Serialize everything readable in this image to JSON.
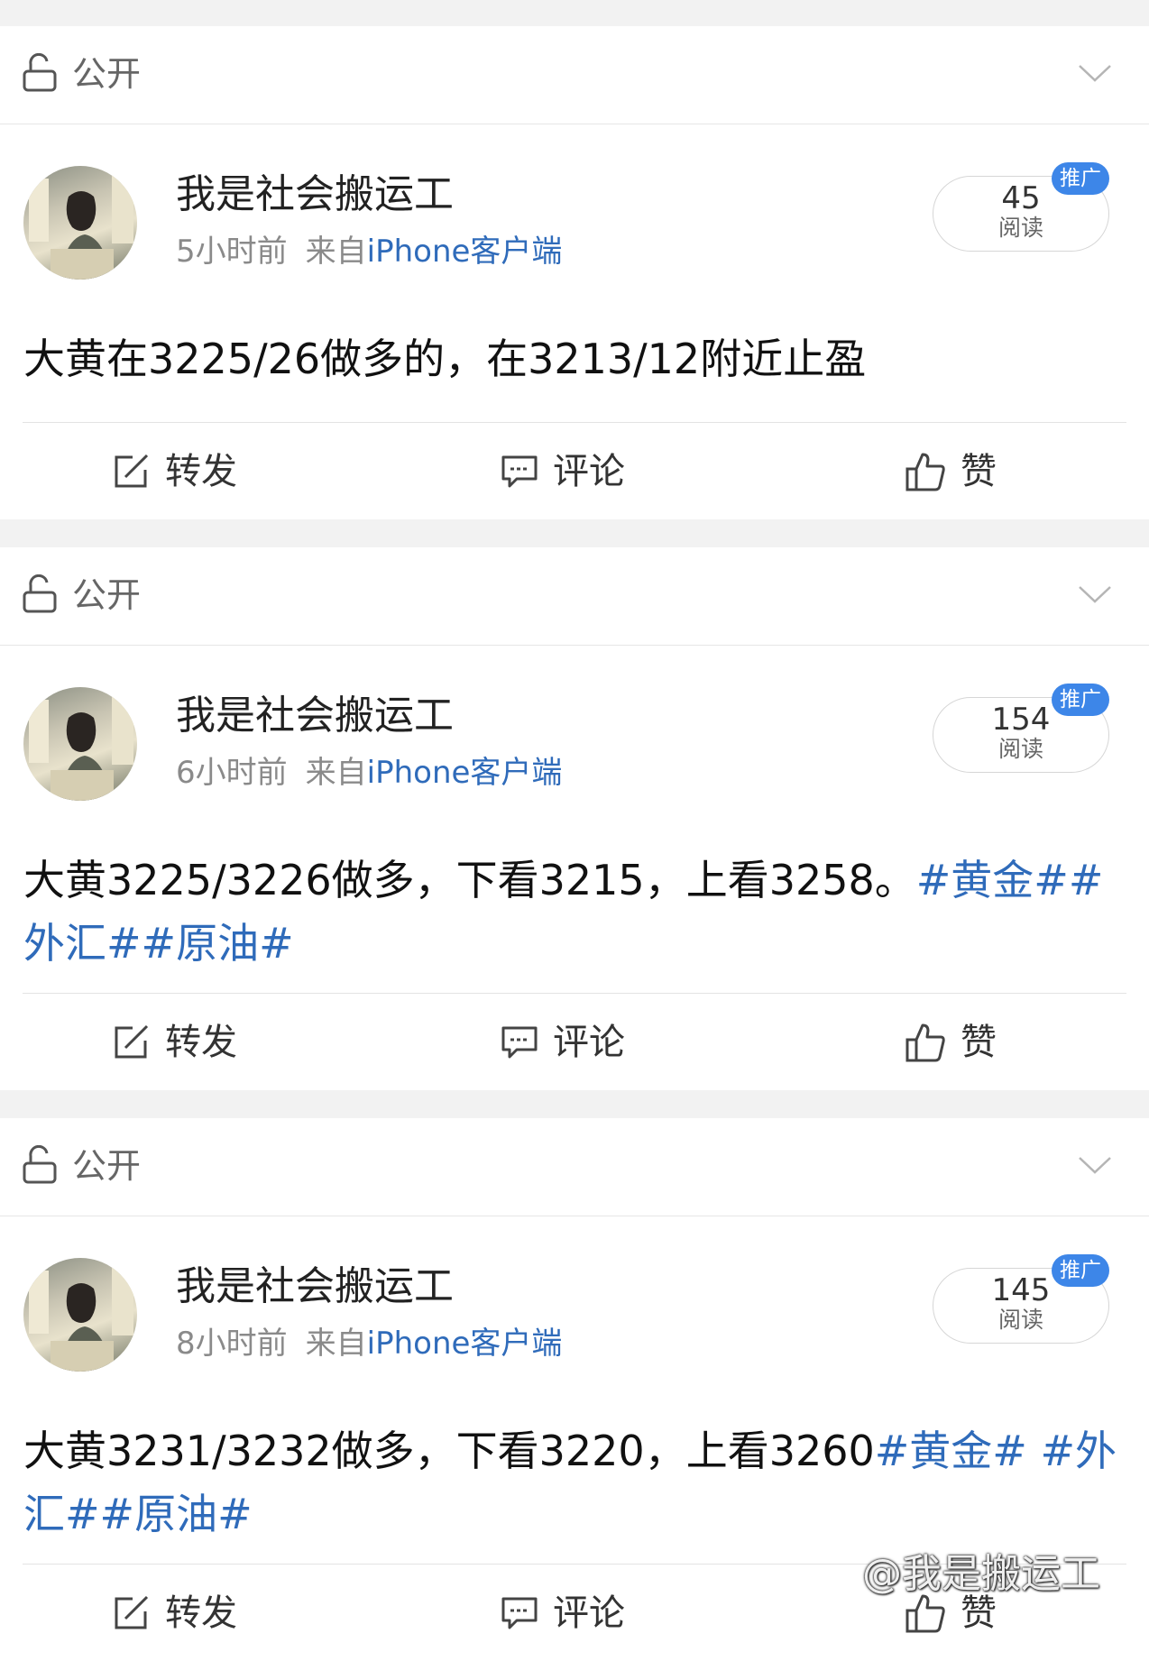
{
  "visibility_label": "公开",
  "repost_label": "转发",
  "comment_label": "评论",
  "like_label": "赞",
  "reads_label": "阅读",
  "promo_label": "推广",
  "posts": [
    {
      "username": "我是社会搬运工",
      "time": "5小时前",
      "via": "来自",
      "client": "iPhone客户端",
      "reads": "45",
      "text": "大黄在3225/26做多的，在3213/12附近止盈",
      "tags": ""
    },
    {
      "username": "我是社会搬运工",
      "time": "6小时前",
      "via": "来自",
      "client": "iPhone客户端",
      "reads": "154",
      "text": "大黄3225/3226做多，下看3215，上看3258。",
      "tags": "#黄金##外汇##原油#"
    },
    {
      "username": "我是社会搬运工",
      "time": "8小时前",
      "via": "来自",
      "client": "iPhone客户端",
      "reads": "145",
      "text": "大黄3231/3232做多，下看3220，上看3260",
      "tags": "#黄金# #外汇##原油#"
    }
  ],
  "watermark": "@我是搬运工"
}
